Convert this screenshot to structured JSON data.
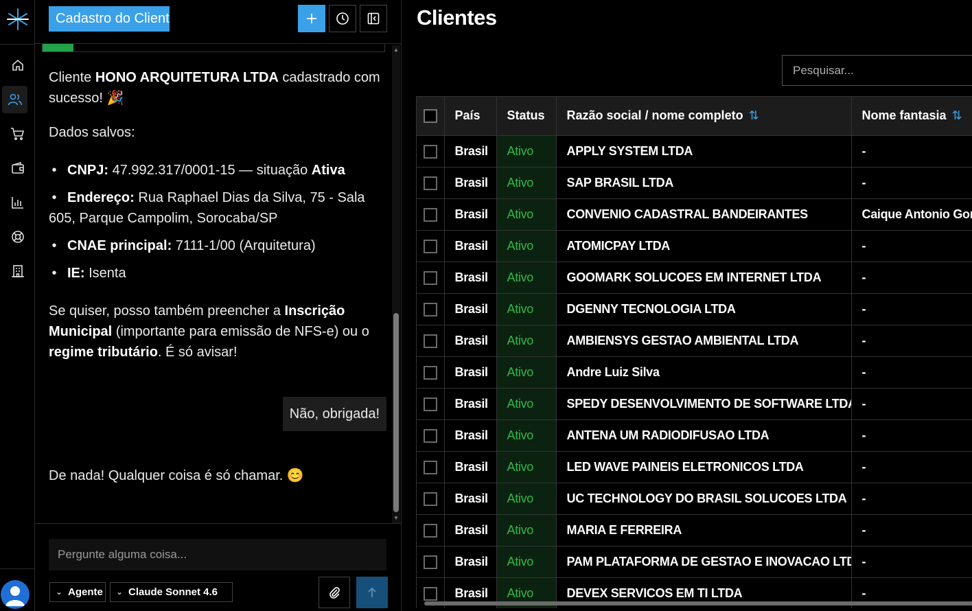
{
  "chat": {
    "title": "Cadastro do Client",
    "progress": 0.09,
    "messages": {
      "success_pre": "Cliente ",
      "success_company": "HONO ARQUITETURA LTDA",
      "success_post": " cadastrado com sucesso! 🎉",
      "saved_heading": "Dados salvos:",
      "bullets": [
        {
          "label": "CNPJ:",
          "value": " 47.992.317/0001-15 — situação ",
          "extra_bold": "Ativa"
        },
        {
          "label": "Endereço:",
          "value": " Rua Raphael Dias da Silva, 75 - Sala 605, Parque Campolim, Sorocaba/SP",
          "extra_bold": ""
        },
        {
          "label": "CNAE principal:",
          "value": " 7111-1/00 (Arquitetura)",
          "extra_bold": ""
        },
        {
          "label": "IE:",
          "value": " Isenta",
          "extra_bold": ""
        }
      ],
      "offer_1": "Se quiser, posso também preencher a ",
      "offer_b1": "Inscrição Municipal",
      "offer_2": " (importante para emissão de NFS-e) ou o ",
      "offer_b2": "regime tributário",
      "offer_3": ". É só avisar!",
      "user_reply": "Não, obrigada!",
      "final_reply": "De nada! Qualquer coisa é só chamar. 😊"
    },
    "composer": {
      "placeholder": "Pergunte alguma coisa...",
      "agent_label": "Agente",
      "model_label": "Claude Sonnet 4.6"
    }
  },
  "main": {
    "title": "Clientes",
    "search_placeholder": "Pesquisar...",
    "columns": [
      "País",
      "Status",
      "Razão social / nome completo",
      "Nome fantasia"
    ],
    "rows": [
      {
        "pais": "Brasil",
        "status": "Ativo",
        "razao": "APPLY SYSTEM LTDA",
        "fantasia": "-"
      },
      {
        "pais": "Brasil",
        "status": "Ativo",
        "razao": "SAP BRASIL LTDA",
        "fantasia": "-"
      },
      {
        "pais": "Brasil",
        "status": "Ativo",
        "razao": "CONVENIO CADASTRAL BANDEIRANTES",
        "fantasia": "Caique Antonio Gom"
      },
      {
        "pais": "Brasil",
        "status": "Ativo",
        "razao": "ATOMICPAY LTDA",
        "fantasia": "-"
      },
      {
        "pais": "Brasil",
        "status": "Ativo",
        "razao": "GOOMARK SOLUCOES EM INTERNET LTDA",
        "fantasia": "-"
      },
      {
        "pais": "Brasil",
        "status": "Ativo",
        "razao": "DGENNY TECNOLOGIA LTDA",
        "fantasia": "-"
      },
      {
        "pais": "Brasil",
        "status": "Ativo",
        "razao": "AMBIENSYS GESTAO AMBIENTAL LTDA",
        "fantasia": "-"
      },
      {
        "pais": "Brasil",
        "status": "Ativo",
        "razao": "Andre Luiz Silva",
        "fantasia": "-"
      },
      {
        "pais": "Brasil",
        "status": "Ativo",
        "razao": "SPEDY DESENVOLVIMENTO DE SOFTWARE LTDA",
        "fantasia": "-"
      },
      {
        "pais": "Brasil",
        "status": "Ativo",
        "razao": "ANTENA UM RADIODIFUSAO LTDA",
        "fantasia": "-"
      },
      {
        "pais": "Brasil",
        "status": "Ativo",
        "razao": "LED WAVE PAINEIS ELETRONICOS LTDA",
        "fantasia": "-"
      },
      {
        "pais": "Brasil",
        "status": "Ativo",
        "razao": "UC TECHNOLOGY DO BRASIL SOLUCOES LTDA",
        "fantasia": "-"
      },
      {
        "pais": "Brasil",
        "status": "Ativo",
        "razao": "MARIA E FERREIRA",
        "fantasia": "-"
      },
      {
        "pais": "Brasil",
        "status": "Ativo",
        "razao": "PAM PLATAFORMA DE GESTAO E INOVACAO LTDA",
        "fantasia": "-"
      },
      {
        "pais": "Brasil",
        "status": "Ativo",
        "razao": "DEVEX SERVICOS EM TI LTDA",
        "fantasia": "-"
      }
    ]
  },
  "colors": {
    "accent": "#3aa0e8",
    "status_active": "#2fb84a",
    "progress": "#22a34a"
  },
  "icons": {
    "rail": [
      "home-icon",
      "users-icon",
      "cart-icon",
      "wallet-icon",
      "chart-icon",
      "support-icon",
      "building-icon"
    ],
    "header": [
      "plus-icon",
      "history-icon",
      "collapse-panel-icon"
    ],
    "composer": [
      "paperclip-icon",
      "send-arrow-icon"
    ]
  }
}
